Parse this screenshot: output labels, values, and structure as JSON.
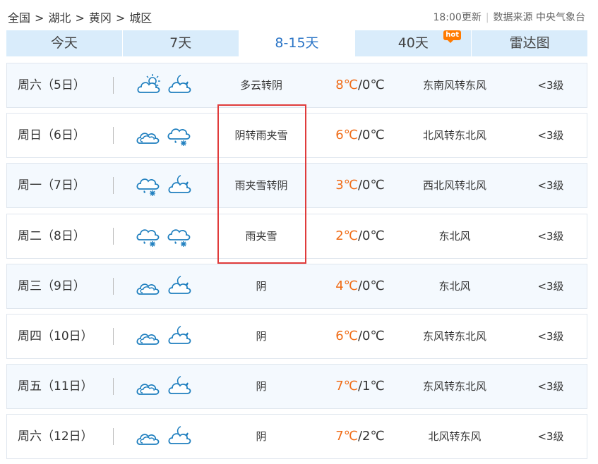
{
  "breadcrumb": [
    "全国",
    "湖北",
    "黄冈",
    "城区"
  ],
  "source": {
    "time": "18:00更新",
    "label": "数据来源 中央气象台"
  },
  "tabs": [
    {
      "label": "今天",
      "active": false
    },
    {
      "label": "7天",
      "active": false
    },
    {
      "label": "8-15天",
      "active": true
    },
    {
      "label": "40天",
      "active": false,
      "badge": "hot"
    },
    {
      "label": "雷达图",
      "active": false
    }
  ],
  "days": [
    {
      "day": "周六（5日）",
      "icons": [
        "partly-cloudy-day-icon",
        "cloudy-night-icon"
      ],
      "weather": "多云转阴",
      "high": "8℃",
      "low": "/0℃",
      "wind": "东南风转东风",
      "level": "<3级"
    },
    {
      "day": "周日（6日）",
      "icons": [
        "cloudy-icon",
        "sleet-icon"
      ],
      "weather": "阴转雨夹雪",
      "high": "6℃",
      "low": "/0℃",
      "wind": "北风转东北风",
      "level": "<3级"
    },
    {
      "day": "周一（7日）",
      "icons": [
        "sleet-icon",
        "cloudy-night-icon"
      ],
      "weather": "雨夹雪转阴",
      "high": "3℃",
      "low": "/0℃",
      "wind": "西北风转北风",
      "level": "<3级"
    },
    {
      "day": "周二（8日）",
      "icons": [
        "sleet-icon",
        "sleet-icon"
      ],
      "weather": "雨夹雪",
      "high": "2℃",
      "low": "/0℃",
      "wind": "东北风",
      "level": "<3级"
    },
    {
      "day": "周三（9日）",
      "icons": [
        "cloudy-icon",
        "cloudy-night-icon"
      ],
      "weather": "阴",
      "high": "4℃",
      "low": "/0℃",
      "wind": "东北风",
      "level": "<3级"
    },
    {
      "day": "周四（10日）",
      "icons": [
        "cloudy-icon",
        "cloudy-night-icon"
      ],
      "weather": "阴",
      "high": "6℃",
      "low": "/0℃",
      "wind": "东风转东北风",
      "level": "<3级"
    },
    {
      "day": "周五（11日）",
      "icons": [
        "cloudy-icon",
        "cloudy-night-icon"
      ],
      "weather": "阴",
      "high": "7℃",
      "low": "/1℃",
      "wind": "东风转东北风",
      "level": "<3级"
    },
    {
      "day": "周六（12日）",
      "icons": [
        "cloudy-icon",
        "cloudy-night-icon"
      ],
      "weather": "阴",
      "high": "7℃",
      "low": "/2℃",
      "wind": "北风转东风",
      "level": "<3级"
    }
  ]
}
